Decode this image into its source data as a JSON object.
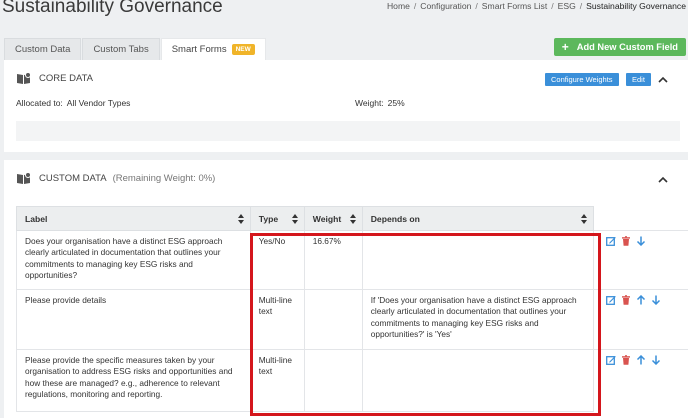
{
  "page": {
    "title": "Sustainability Governance"
  },
  "breadcrumb": [
    "Home",
    "Configuration",
    "Smart Forms List",
    "ESG",
    "Sustainability Governance"
  ],
  "tabs": [
    {
      "label": "Custom Data"
    },
    {
      "label": "Custom Tabs"
    },
    {
      "label": "Smart Forms",
      "badge": "NEW"
    }
  ],
  "add_button": {
    "label": "Add New Custom Field"
  },
  "core": {
    "title": "CORE DATA",
    "configure_label": "Configure Weights",
    "edit_label": "Edit",
    "allocated_label": "Allocated to:",
    "allocated_value": "All Vendor Types",
    "weight_label": "Weight:",
    "weight_value": "25%"
  },
  "custom": {
    "title": "CUSTOM DATA",
    "remaining": "(Remaining Weight: 0%)",
    "columns": [
      "Label",
      "Type",
      "Weight",
      "Depends on"
    ],
    "rows": [
      {
        "label": "Does your organisation have a distinct ESG approach clearly articulated in documentation that outlines your commitments to managing key ESG risks and opportunities?",
        "type": "Yes/No",
        "weight": "16.67%",
        "depends": ""
      },
      {
        "label": "Please provide details",
        "type": "Multi-line text",
        "weight": "",
        "depends": "If 'Does your organisation have a distinct ESG approach clearly articulated in documentation that outlines your commitments to managing key ESG risks and opportunities?' is 'Yes'"
      },
      {
        "label": "Please provide the specific measures taken by your organisation to address ESG risks and opportunities and how these are managed? e.g., adherence to relevant regulations, monitoring and reporting.",
        "type": "Multi-line text",
        "weight": "",
        "depends": ""
      }
    ]
  },
  "colors": {
    "accent": "#3a8fd9",
    "add_green": "#5cb85c",
    "badge": "#f0b429",
    "delete_red": "#d9534f",
    "highlight_red": "#d4161c"
  },
  "icons": {
    "section": "book-icon",
    "edit": "edit-icon",
    "delete": "trash-icon",
    "up": "arrow-up-icon",
    "down": "arrow-down-icon",
    "collapse": "chevron-up-icon",
    "sort": "sort-icon"
  }
}
